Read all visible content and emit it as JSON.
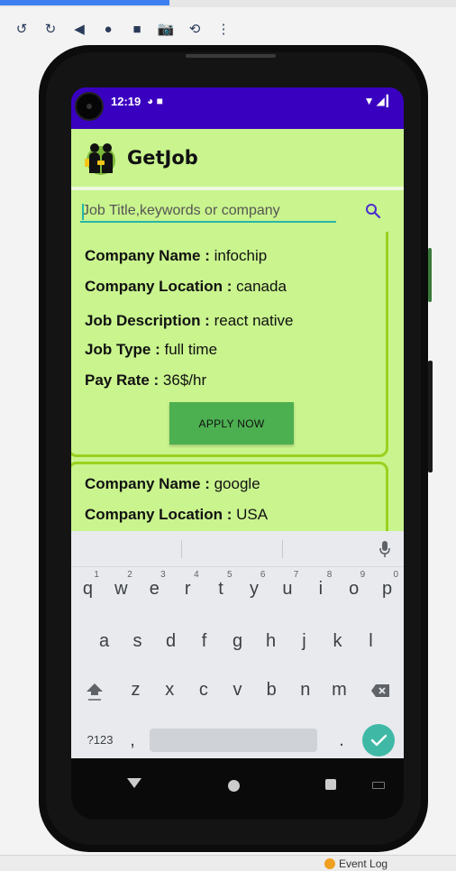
{
  "window": {
    "toolbar_icons": [
      "rotate-left-icon",
      "rotate-right-icon",
      "back-icon",
      "home-icon",
      "overview-icon",
      "camera-icon",
      "undo-icon",
      "more-icon"
    ],
    "bottom_status": "Event Log"
  },
  "statusbar": {
    "time": "12:19",
    "colors": {
      "background": "#3a00c0"
    }
  },
  "app": {
    "title": "GetJob",
    "accent": "#c9f48e",
    "search": {
      "placeholder": "Job Title,keywords or company",
      "value": ""
    }
  },
  "jobs": [
    {
      "company_name_label": "Company Name :",
      "company_name": " infochip",
      "company_location_label": "Company Location :",
      "company_location": " canada",
      "job_description_label": "Job Description :",
      "job_description": " react native",
      "job_type_label": "Job Type :",
      "job_type": " full time",
      "pay_rate_label": "Pay Rate :",
      "pay_rate": " 36$/hr",
      "apply_label": "APPLY NOW"
    },
    {
      "company_name_label": "Company Name :",
      "company_name": " google",
      "company_location_label": "Company Location :",
      "company_location": " USA"
    }
  ],
  "keyboard": {
    "row1": [
      {
        "k": "q",
        "h": "1"
      },
      {
        "k": "w",
        "h": "2"
      },
      {
        "k": "e",
        "h": "3"
      },
      {
        "k": "r",
        "h": "4"
      },
      {
        "k": "t",
        "h": "5"
      },
      {
        "k": "y",
        "h": "6"
      },
      {
        "k": "u",
        "h": "7"
      },
      {
        "k": "i",
        "h": "8"
      },
      {
        "k": "o",
        "h": "9"
      },
      {
        "k": "p",
        "h": "0"
      }
    ],
    "row2": [
      "a",
      "s",
      "d",
      "f",
      "g",
      "h",
      "j",
      "k",
      "l"
    ],
    "row3": [
      "z",
      "x",
      "c",
      "v",
      "b",
      "n",
      "m"
    ],
    "symbols_label": "?123",
    "comma": ",",
    "period": "."
  }
}
